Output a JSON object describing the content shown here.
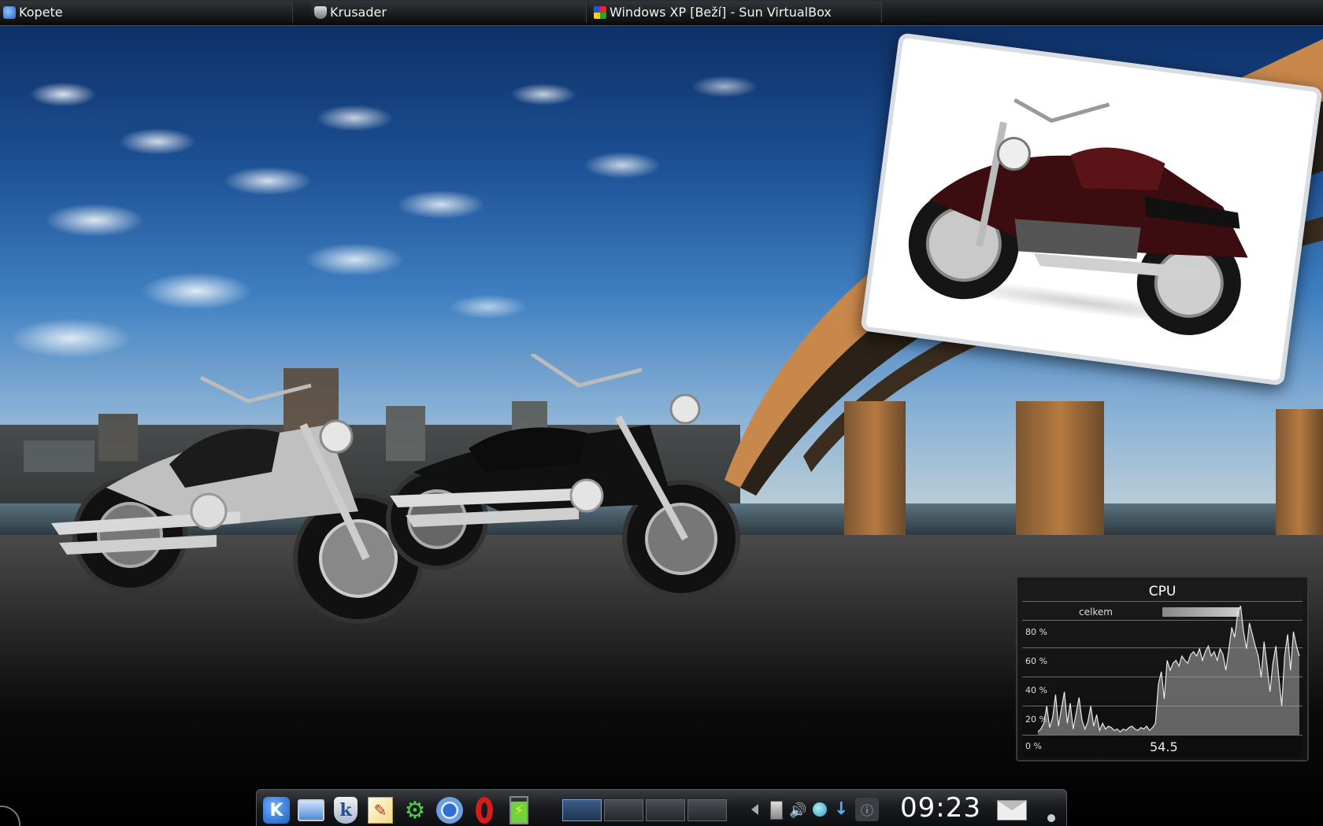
{
  "taskbar": {
    "tasks": [
      {
        "label": "Kopete",
        "icon": "kopete-icon"
      },
      {
        "label": "Krusader",
        "icon": "krusader-icon"
      },
      {
        "label": "Windows XP [Beží] - Sun VirtualBox",
        "icon": "virtualbox-icon"
      }
    ]
  },
  "cpu_widget": {
    "title": "CPU",
    "legend": "celkem",
    "current_value": "54.5",
    "ticks": [
      "80 %",
      "60 %",
      "40 %",
      "20 %",
      "0 %"
    ]
  },
  "chart_data": {
    "type": "area",
    "title": "CPU",
    "series": [
      {
        "name": "celkem",
        "values": [
          2,
          4,
          8,
          20,
          5,
          12,
          28,
          6,
          18,
          30,
          8,
          22,
          4,
          15,
          26,
          10,
          4,
          9,
          20,
          6,
          14,
          3,
          8,
          4,
          6,
          5,
          3,
          4,
          2,
          4,
          3,
          5,
          6,
          4,
          3,
          5,
          4,
          6,
          3,
          5,
          8,
          35,
          44,
          25,
          52,
          45,
          50,
          52,
          48,
          55,
          52,
          50,
          56,
          58,
          55,
          60,
          52,
          58,
          62,
          55,
          58,
          52,
          60,
          56,
          45,
          60,
          75,
          68,
          85,
          90,
          72,
          60,
          78,
          70,
          62,
          55,
          40,
          65,
          48,
          30,
          50,
          62,
          40,
          20,
          55,
          70,
          45,
          72,
          62,
          55
        ]
      }
    ],
    "ylim": [
      0,
      100
    ],
    "ylabels": [
      "0 %",
      "20 %",
      "40 %",
      "60 %",
      "80 %"
    ],
    "grid": true,
    "legend": "top"
  },
  "panel": {
    "launchers": [
      {
        "name": "kde-menu-icon",
        "glyph": "K"
      },
      {
        "name": "desktop-icon",
        "glyph": "🖥"
      },
      {
        "name": "konqueror-icon",
        "glyph": "k"
      },
      {
        "name": "kwrite-icon",
        "glyph": "✎"
      },
      {
        "name": "network-icon",
        "glyph": "⚙"
      },
      {
        "name": "chromium-icon",
        "glyph": "◉"
      },
      {
        "name": "opera-icon",
        "glyph": "O"
      },
      {
        "name": "battery-icon",
        "glyph": "⚡"
      }
    ],
    "pager_count": 4,
    "clock": "09:23",
    "accent": "#2d6bd1"
  }
}
